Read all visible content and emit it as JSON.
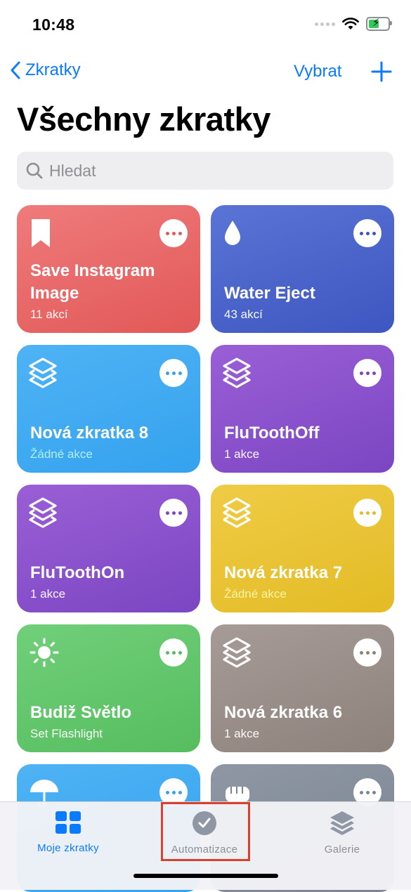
{
  "status_bar": {
    "time": "10:48"
  },
  "nav": {
    "back_label": "Zkratky",
    "select_label": "Vybrat"
  },
  "title": "Všechny zkratky",
  "search": {
    "placeholder": "Hledat"
  },
  "shortcuts": [
    {
      "name": "Save Instagram Image",
      "subtitle": "11 akcí",
      "color": "#e86a6a",
      "icon": "bookmark-icon"
    },
    {
      "name": "Water Eject",
      "subtitle": "43 akcí",
      "color": "#4c64cc",
      "icon": "water-drop-icon"
    },
    {
      "name": "Nová zkratka 8",
      "subtitle": "Žádné akce",
      "color": "#3ea9f1",
      "icon": "layers-icon"
    },
    {
      "name": "FluToothOff",
      "subtitle": "1 akce",
      "color": "#8a51cc",
      "icon": "layers-icon"
    },
    {
      "name": "FluToothOn",
      "subtitle": "1 akce",
      "color": "#8a51cc",
      "icon": "layers-icon"
    },
    {
      "name": "Nová zkratka 7",
      "subtitle": "Žádné akce",
      "color": "#e9c335",
      "icon": "layers-icon"
    },
    {
      "name": "Budiž Světlo",
      "subtitle": "Set Flashlight",
      "color": "#62c66b",
      "icon": "sun-icon"
    },
    {
      "name": "Nová zkratka 6",
      "subtitle": "1 akce",
      "color": "#998e89",
      "icon": "layers-icon"
    },
    {
      "name": "",
      "subtitle": "",
      "color": "#3ea9f1",
      "icon": "umbrella-icon"
    },
    {
      "name": "",
      "subtitle": "",
      "color": "#858e9a",
      "icon": "fist-icon"
    }
  ],
  "tabbar": {
    "tabs": [
      {
        "label": "Moje zkratky",
        "icon": "grid-icon",
        "active": true
      },
      {
        "label": "Automatizace",
        "icon": "clock-icon",
        "active": false
      },
      {
        "label": "Galerie",
        "icon": "stack-icon",
        "active": false
      }
    ]
  }
}
